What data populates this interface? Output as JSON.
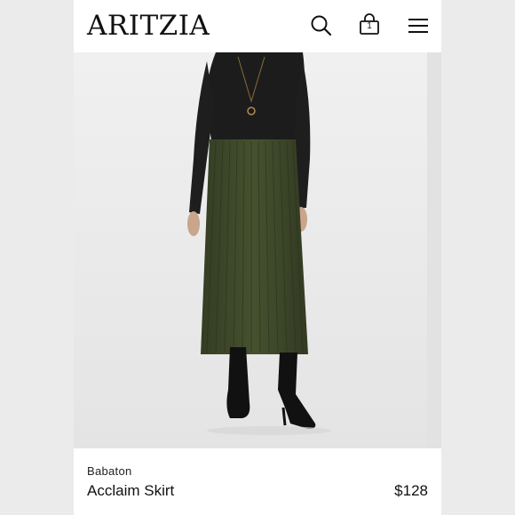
{
  "header": {
    "logo": "ARITZIA",
    "bag_count": "1",
    "icons": [
      "search-icon",
      "shopping-bag-icon",
      "menu-icon"
    ]
  },
  "product": {
    "brand": "Babaton",
    "name": "Acclaim Skirt",
    "price": "$128",
    "skirt_color": "#3f4a2c"
  }
}
